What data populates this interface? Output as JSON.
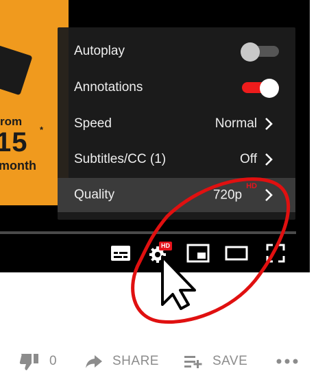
{
  "thumbnail": {
    "line1": "rom",
    "price": "15",
    "star": "*",
    "line3": "month"
  },
  "settings": {
    "autoplay": {
      "label": "Autoplay",
      "enabled": false
    },
    "annotations": {
      "label": "Annotations",
      "enabled": true
    },
    "speed": {
      "label": "Speed",
      "value": "Normal"
    },
    "subtitles": {
      "label": "Subtitles/CC (1)",
      "value": "Off"
    },
    "quality": {
      "label": "Quality",
      "value": "720p",
      "badge": "HD"
    }
  },
  "controls": {
    "settings_badge": "HD",
    "icons": [
      "subtitles-icon",
      "settings-gear-icon",
      "miniplayer-icon",
      "theater-mode-icon",
      "fullscreen-icon"
    ]
  },
  "actions": {
    "dislike_count": "0",
    "share_label": "SHARE",
    "save_label": "SAVE"
  },
  "colors": {
    "accent_red": "#e5141c",
    "toggle_on": "#ee1c1c",
    "annotation": "#e01010",
    "muted_text": "#8c8c8c"
  }
}
